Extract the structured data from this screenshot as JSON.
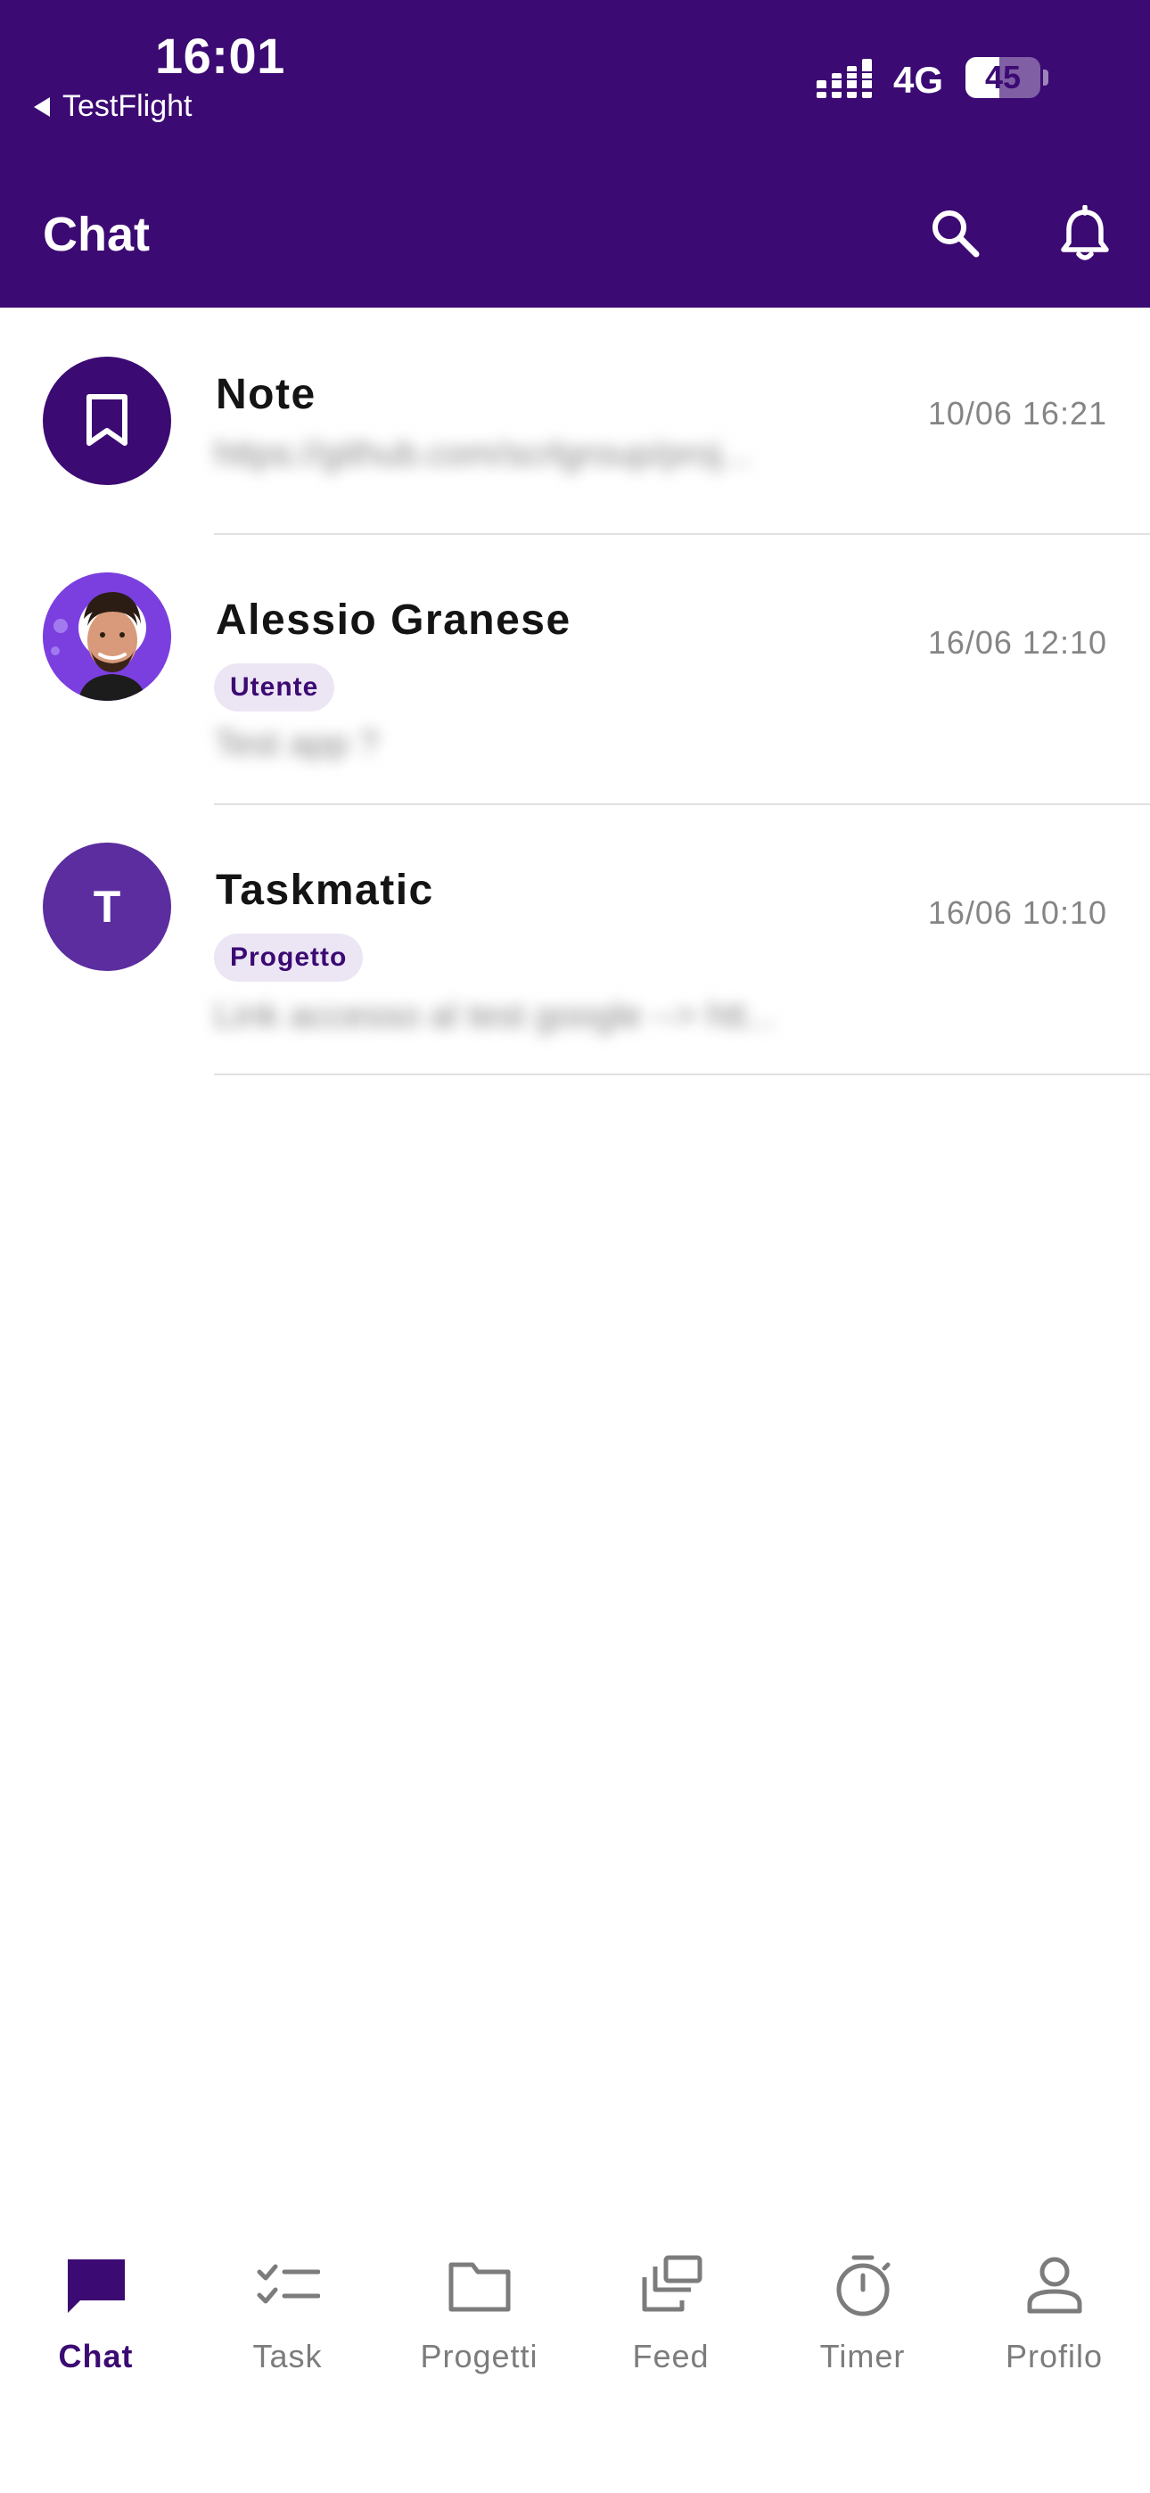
{
  "status_bar": {
    "time": "16:01",
    "back_app": "TestFlight",
    "network": "4G",
    "battery": "45",
    "battery_level": 0.45
  },
  "app_bar": {
    "title": "Chat",
    "search_icon": "search-icon",
    "notifications_icon": "bell-icon"
  },
  "colors": {
    "primary": "#3c0a73",
    "avatar_secondary": "#5b2d9e",
    "badge_bg": "#ece6f4",
    "muted_text": "#858585"
  },
  "chats": [
    {
      "name": "Note",
      "time": "10/06 16:21",
      "preview": "https://github.com/scrlgroup/proj...",
      "avatar_icon": "bookmark-icon"
    },
    {
      "name": "Alessio Granese",
      "badge": "Utente",
      "time": "16/06 12:10",
      "preview": "Test app ?",
      "avatar_icon": "user-photo"
    },
    {
      "name": "Taskmatic",
      "badge": "Progetto",
      "time": "16/06 10:10",
      "preview": "Link accesso al test google --> htt...",
      "avatar_initial": "T"
    }
  ],
  "bottom_nav": [
    {
      "label": "Chat",
      "icon": "chat-bubble-icon",
      "active": true
    },
    {
      "label": "Task",
      "icon": "checklist-icon"
    },
    {
      "label": "Progetti",
      "icon": "folder-icon"
    },
    {
      "label": "Feed",
      "icon": "stacked-cards-icon"
    },
    {
      "label": "Timer",
      "icon": "stopwatch-icon"
    },
    {
      "label": "Profilo",
      "icon": "person-icon"
    }
  ]
}
